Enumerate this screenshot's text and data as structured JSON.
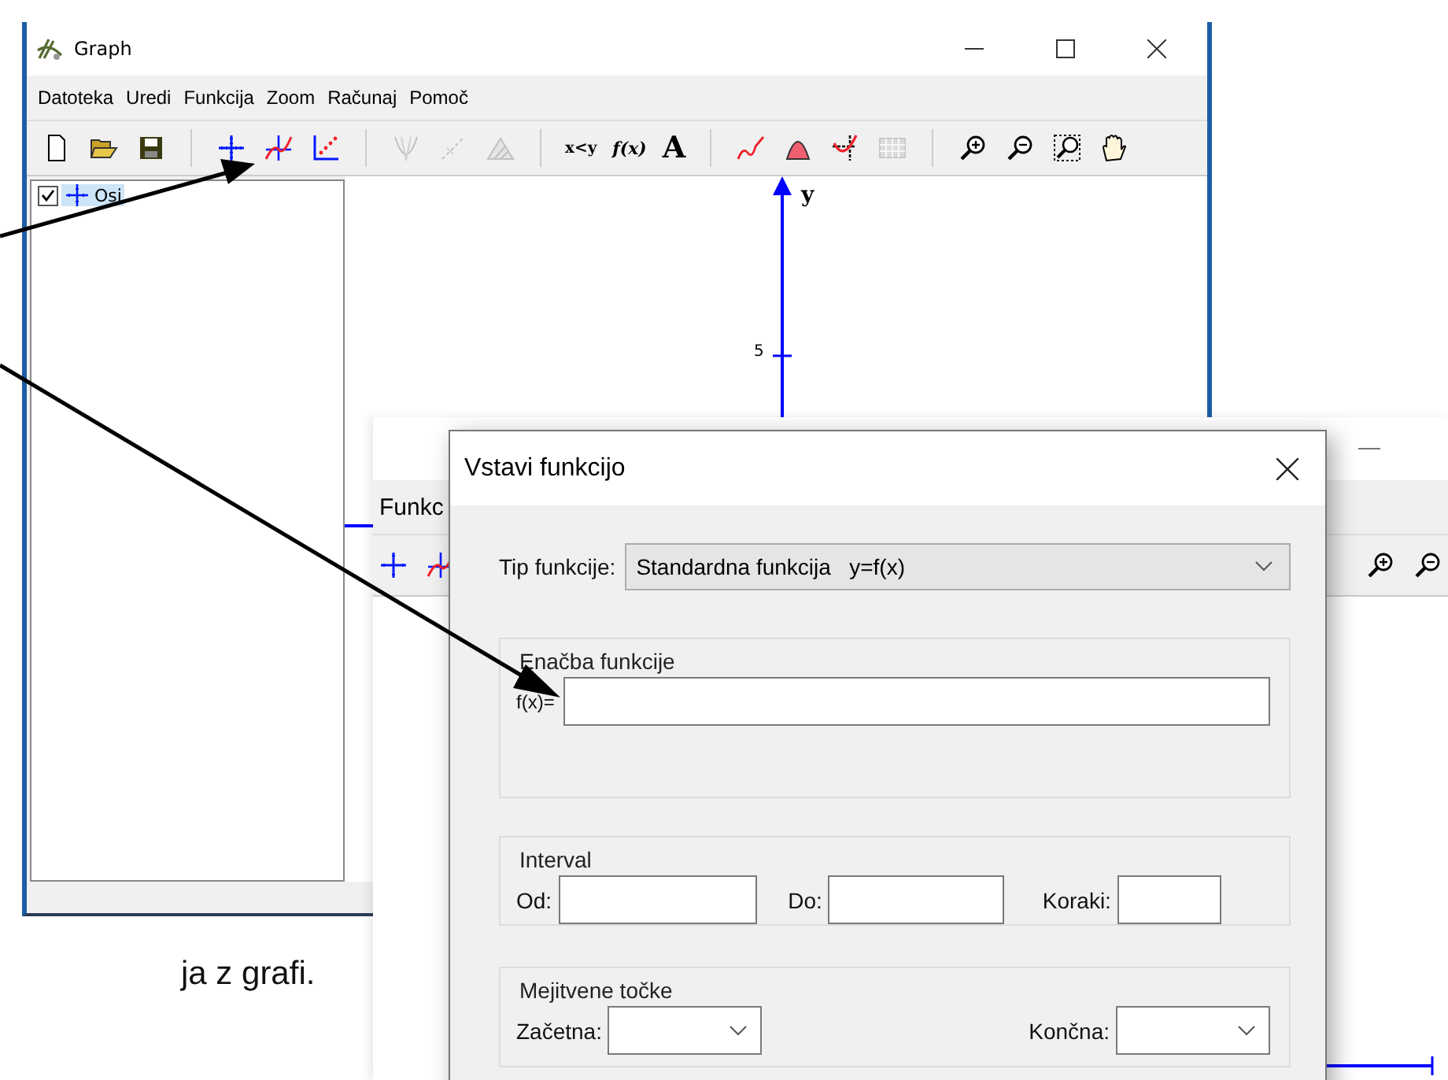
{
  "main_window": {
    "title": "Graph",
    "menu": [
      "Datoteka",
      "Uredi",
      "Funkcija",
      "Zoom",
      "Računaj",
      "Pomoč"
    ],
    "toolbar": [
      {
        "kind": "new",
        "disabled": false
      },
      {
        "kind": "open",
        "disabled": false
      },
      {
        "kind": "save",
        "disabled": false
      },
      {
        "kind": "separator"
      },
      {
        "kind": "axes",
        "disabled": false
      },
      {
        "kind": "function",
        "disabled": false
      },
      {
        "kind": "series",
        "disabled": false
      },
      {
        "kind": "separator"
      },
      {
        "kind": "tangent",
        "disabled": true
      },
      {
        "kind": "normal",
        "disabled": true
      },
      {
        "kind": "shade",
        "disabled": true
      },
      {
        "kind": "separator"
      },
      {
        "kind": "relation",
        "label": "x<y",
        "disabled": false
      },
      {
        "kind": "func-text",
        "label": "f(x)",
        "disabled": false
      },
      {
        "kind": "label-text",
        "label": "A",
        "disabled": false
      },
      {
        "kind": "separator"
      },
      {
        "kind": "curve",
        "disabled": false
      },
      {
        "kind": "area",
        "disabled": false
      },
      {
        "kind": "fit",
        "disabled": false
      },
      {
        "kind": "table",
        "disabled": true
      },
      {
        "kind": "separator"
      },
      {
        "kind": "zoom-in",
        "disabled": false
      },
      {
        "kind": "zoom-out",
        "disabled": false
      },
      {
        "kind": "zoom-box",
        "disabled": false
      },
      {
        "kind": "hand",
        "disabled": false
      }
    ],
    "tree": [
      {
        "label": "Osi",
        "checked": true,
        "selected": true
      }
    ],
    "axis_label": "y",
    "tick": "5"
  },
  "back_window": {
    "menu": [
      "Funkc"
    ],
    "toolbar_left": [
      {
        "kind": "axes",
        "disabled": false
      },
      {
        "kind": "function",
        "disabled": false
      }
    ],
    "toolbar_right": [
      {
        "kind": "zoom-in",
        "disabled": false
      },
      {
        "kind": "zoom-out",
        "disabled": false
      }
    ]
  },
  "dialog": {
    "title": "Vstavi funkcijo",
    "type_label": "Tip funkcije:",
    "type_value": "Standardna funkcija   y=f(x)",
    "equation_group": "Enačba funkcije",
    "equation_label": "f(x)=",
    "interval_group": "Interval",
    "interval_fields": [
      {
        "label": "Od:"
      },
      {
        "label": "Do:"
      },
      {
        "label": "Koraki:"
      }
    ],
    "limits_group": "Mejitvene točke",
    "limit_fields": [
      {
        "label": "Začetna:"
      },
      {
        "label": "Končna:"
      }
    ]
  },
  "document_text": "ja z grafi."
}
